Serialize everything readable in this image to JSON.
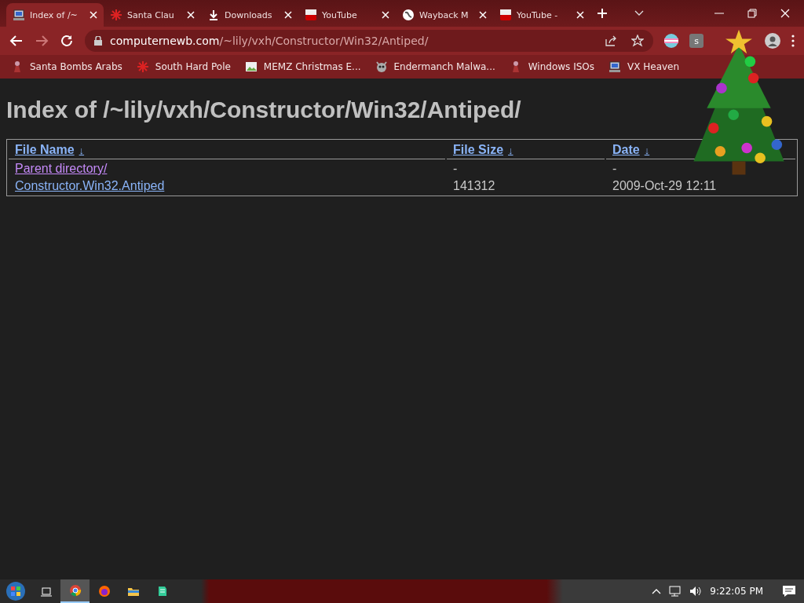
{
  "tabs": [
    {
      "title": "Index of /~",
      "kind": "computer",
      "selected": true
    },
    {
      "title": "Santa Clau",
      "kind": "snowflake",
      "selected": false
    },
    {
      "title": "Downloads",
      "kind": "download",
      "selected": false
    },
    {
      "title": "YouTube",
      "kind": "youtube",
      "selected": false
    },
    {
      "title": "Wayback M",
      "kind": "globe",
      "selected": false
    },
    {
      "title": "YouTube -",
      "kind": "youtube",
      "selected": false
    }
  ],
  "address": {
    "host": "computernewb.com",
    "path": "/~lily/vxh/Constructor/Win32/Antiped/"
  },
  "extensions": [
    {
      "kind": "flag"
    },
    {
      "kind": "letter",
      "label": "s"
    }
  ],
  "bookmarks": [
    {
      "title": "Santa Bombs Arabs",
      "kind": "figure"
    },
    {
      "title": "South Hard Pole",
      "kind": "snowflake"
    },
    {
      "title": "MEMZ Christmas E...",
      "kind": "image"
    },
    {
      "title": "Endermanch Malwa...",
      "kind": "face"
    },
    {
      "title": "Windows ISOs",
      "kind": "figure"
    },
    {
      "title": "VX Heaven",
      "kind": "computer"
    }
  ],
  "page": {
    "heading": "Index of /~lily/vxh/Constructor/Win32/Antiped/",
    "table": {
      "columns": [
        {
          "label": "File Name",
          "sort": "↓"
        },
        {
          "label": "File Size",
          "sort": "↓"
        },
        {
          "label": "Date",
          "sort": "↓"
        }
      ],
      "rows": [
        {
          "name": "Parent directory/",
          "visited": true,
          "size": "-",
          "date": "-"
        },
        {
          "name": "Constructor.Win32.Antiped",
          "visited": false,
          "size": "141312",
          "date": "2009-Oct-29 12:11"
        }
      ]
    }
  },
  "taskbar": {
    "apps": [
      {
        "kind": "taskview",
        "selected": false
      },
      {
        "kind": "chrome",
        "selected": true
      },
      {
        "kind": "firefox",
        "selected": false
      },
      {
        "kind": "explorer",
        "selected": false
      },
      {
        "kind": "notes",
        "selected": false
      }
    ],
    "time": "9:22:05 PM"
  }
}
